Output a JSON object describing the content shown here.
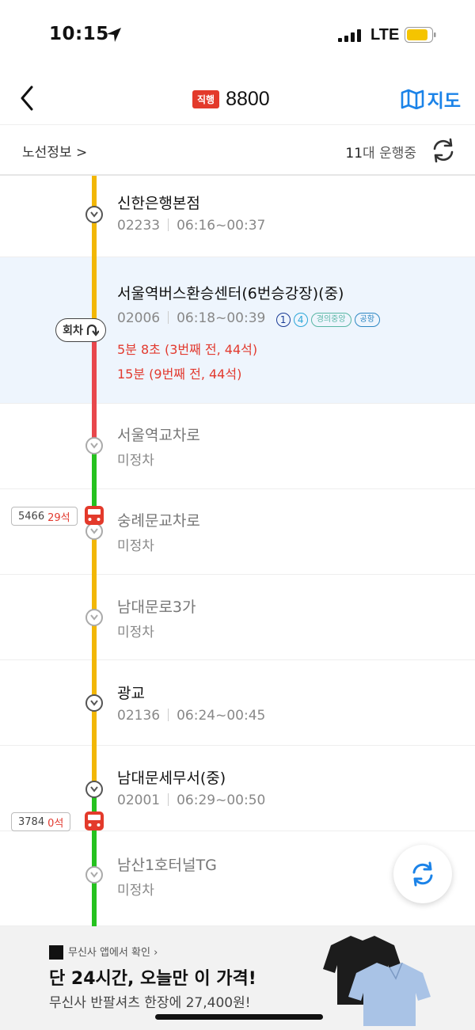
{
  "status_bar": {
    "time": "10:15",
    "network": "LTE"
  },
  "header": {
    "route_badge": "직행",
    "route_number": "8800",
    "map_label": "지도"
  },
  "info_bar": {
    "route_info_label": "노선정보 >",
    "running_count": "11",
    "running_suffix": "대 운행중"
  },
  "turn_point_label": "회차",
  "stops": [
    {
      "name": "신한은행본점",
      "id": "02233",
      "hours": "06:16~00:37"
    },
    {
      "name": "서울역버스환승센터(6번승강장)(중)",
      "id": "02006",
      "hours": "06:18~00:39",
      "transfer_lines": [
        "1",
        "4",
        "경의중앙",
        "공항"
      ],
      "arrivals": [
        "5분 8초 (3번째 전, 44석)",
        "15분 (9번째 전, 44석)"
      ]
    },
    {
      "name": "서울역교차로",
      "status": "미정차"
    },
    {
      "name": "숭례문교차로",
      "status": "미정차"
    },
    {
      "name": "남대문로3가",
      "status": "미정차"
    },
    {
      "name": "광교",
      "id": "02136",
      "hours": "06:24~00:45"
    },
    {
      "name": "남대문세무서(중)",
      "id": "02001",
      "hours": "06:29~00:50"
    },
    {
      "name": "남산1호터널TG",
      "status": "미정차"
    }
  ],
  "buses": [
    {
      "plate": "5466",
      "seats": "29석"
    },
    {
      "plate": "3784",
      "seats": "0석"
    }
  ],
  "colors": {
    "accent": "#1b83e8",
    "route_red": "#e33a2b",
    "line_yellow": "#f2b705",
    "line_red": "#e8474c",
    "line_green": "#25c21f"
  },
  "ad": {
    "source": "무신사 앱에서 확인 ›",
    "headline": "단 24시간, 오늘만 이 가격!",
    "sub": "무신사 반팔셔츠 한장에 27,400원!"
  }
}
